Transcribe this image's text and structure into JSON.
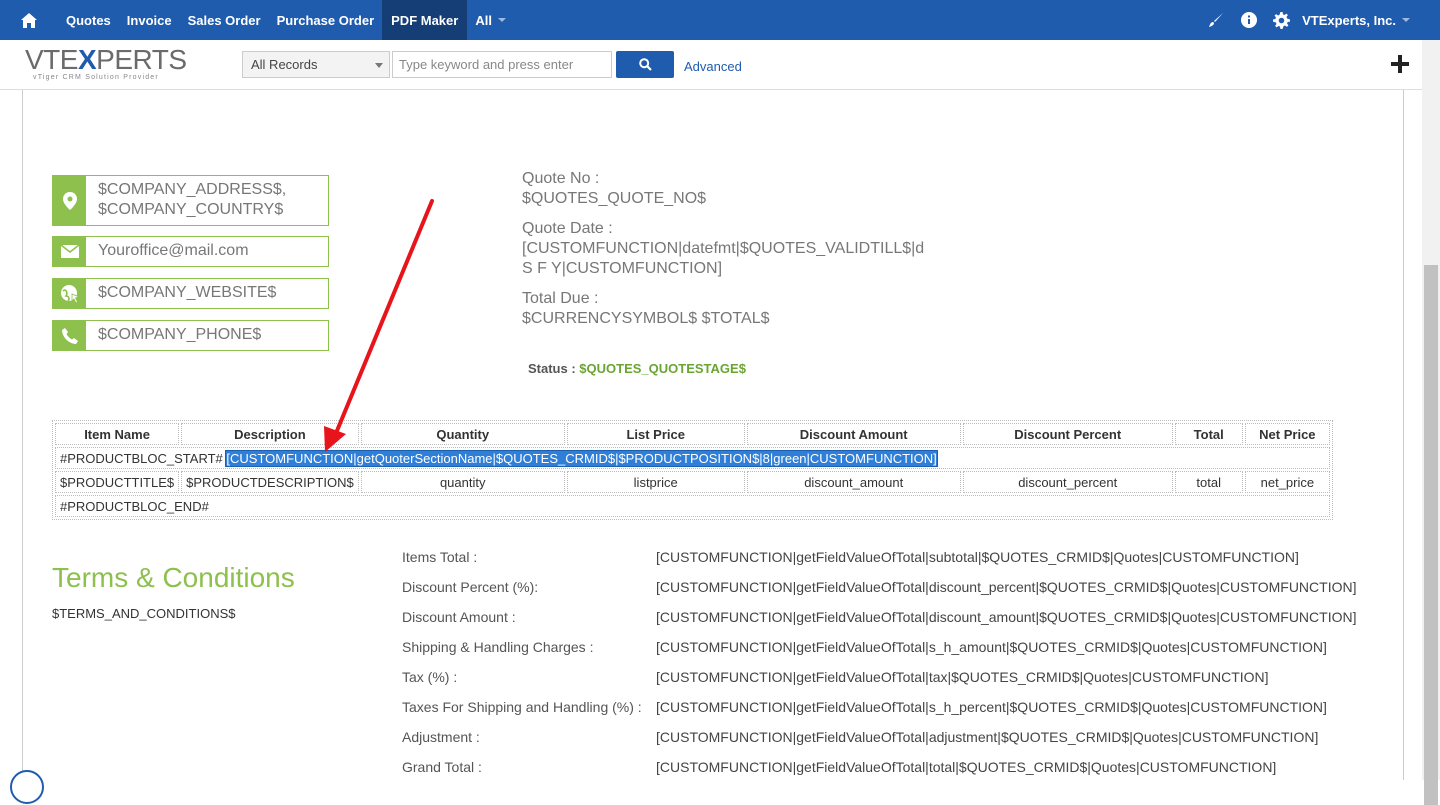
{
  "nav": {
    "items": [
      "Quotes",
      "Invoice",
      "Sales Order",
      "Purchase Order",
      "PDF Maker",
      "All"
    ],
    "active": "PDF Maker",
    "account": "VTExperts, Inc."
  },
  "toolbar": {
    "logo_main_pre": "VTE",
    "logo_main_x": "X",
    "logo_main_post": "PERTS",
    "logo_sub": "vTiger CRM Solution Provider",
    "records_select": "All Records",
    "search_placeholder": "Type keyword and press enter",
    "advanced": "Advanced"
  },
  "company": {
    "address": "$COMPANY_ADDRESS$,",
    "country": "$COMPANY_COUNTRY$",
    "email": "Youroffice@mail.com",
    "website": "$COMPANY_WEBSITE$",
    "phone": "$COMPANY_PHONE$"
  },
  "quote": {
    "no_label": "Quote No :",
    "no_value": "$QUOTES_QUOTE_NO$",
    "date_label": "Quote Date :",
    "date_value_1": "[CUSTOMFUNCTION|datefmt|$QUOTES_VALIDTILL$|d",
    "date_value_2": "S F Y|CUSTOMFUNCTION]",
    "due_label": "Total Due :",
    "due_value": "$CURRENCYSYMBOL$ $TOTAL$",
    "status_label": "Status :",
    "status_value": "$QUOTES_QUOTESTAGE$"
  },
  "product_table": {
    "headers": [
      "Item Name",
      "Description",
      "Quantity",
      "List Price",
      "Discount Amount",
      "Discount Percent",
      "Total",
      "Net Price"
    ],
    "bloc_start": "#PRODUCTBLOC_START#",
    "bloc_start_selected": "[CUSTOMFUNCTION|getQuoterSectionName|$QUOTES_CRMID$|$PRODUCTPOSITION$|8|green|CUSTOMFUNCTION]",
    "row": [
      "$PRODUCTTITLE$",
      "$PRODUCTDESCRIPTION$",
      "quantity",
      "listprice",
      "discount_amount",
      "discount_percent",
      "total",
      "net_price"
    ],
    "bloc_end": "#PRODUCTBLOC_END#"
  },
  "terms": {
    "title": "Terms & Conditions",
    "body": "$TERMS_AND_CONDITIONS$"
  },
  "totals": [
    {
      "label": "Items Total :",
      "value": "[CUSTOMFUNCTION|getFieldValueOfTotal|subtotal|$QUOTES_CRMID$|Quotes|CUSTOMFUNCTION]"
    },
    {
      "label": "Discount Percent (%):",
      "value": "[CUSTOMFUNCTION|getFieldValueOfTotal|discount_percent|$QUOTES_CRMID$|Quotes|CUSTOMFUNCTION]"
    },
    {
      "label": "Discount Amount :",
      "value": "[CUSTOMFUNCTION|getFieldValueOfTotal|discount_amount|$QUOTES_CRMID$|Quotes|CUSTOMFUNCTION]"
    },
    {
      "label": "Shipping & Handling Charges :",
      "value": "[CUSTOMFUNCTION|getFieldValueOfTotal|s_h_amount|$QUOTES_CRMID$|Quotes|CUSTOMFUNCTION]"
    },
    {
      "label": "Tax (%) :",
      "value": "[CUSTOMFUNCTION|getFieldValueOfTotal|tax|$QUOTES_CRMID$|Quotes|CUSTOMFUNCTION]"
    },
    {
      "label": "Taxes For Shipping and Handling (%) :",
      "value": "[CUSTOMFUNCTION|getFieldValueOfTotal|s_h_percent|$QUOTES_CRMID$|Quotes|CUSTOMFUNCTION]"
    },
    {
      "label": "Adjustment :",
      "value": "[CUSTOMFUNCTION|getFieldValueOfTotal|adjustment|$QUOTES_CRMID$|Quotes|CUSTOMFUNCTION]"
    },
    {
      "label": "Grand Total :",
      "value": "[CUSTOMFUNCTION|getFieldValueOfTotal|total|$QUOTES_CRMID$|Quotes|CUSTOMFUNCTION]"
    }
  ],
  "colors": {
    "nav_bg": "#1f5cad",
    "nav_active": "#143e75",
    "accent_green": "#8dc04c",
    "selection_blue": "#2f7fd8",
    "annotation_arrow": "#e8141b"
  }
}
